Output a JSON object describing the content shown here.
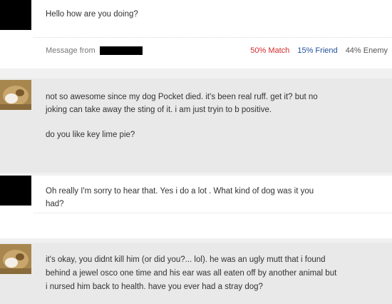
{
  "messages": [
    {
      "sender": "other",
      "lines": [
        "Hello how are you doing?"
      ],
      "meta": {
        "message_from_label": "Message from",
        "match": "50% Match",
        "friend": "15% Friend",
        "enemy": "44% Enemy"
      }
    },
    {
      "sender": "me",
      "lines": [
        "not so awesome since my dog Pocket died. it's been real ruff. get it? but no",
        "joking can take away the sting of it. i am just tryin to b positive.",
        "",
        "do you like key lime pie?"
      ]
    },
    {
      "sender": "other",
      "lines": [
        "Oh really I'm sorry to hear that. Yes i do a lot . What kind of dog was it you",
        "had?"
      ]
    },
    {
      "sender": "me",
      "lines": [
        "it's okay, you didnt kill him (or did you?... lol). he was an ugly mutt that i found",
        "behind a jewel osco one time and his ear was all eaten off by another animal but",
        "i nursed him back to health. have you ever had a stray dog?"
      ]
    }
  ],
  "colors": {
    "match": "#d22b2b",
    "friend": "#1f4f9a",
    "incoming_bg": "#e9e9e9",
    "outgoing_bg": "#ffffff"
  }
}
